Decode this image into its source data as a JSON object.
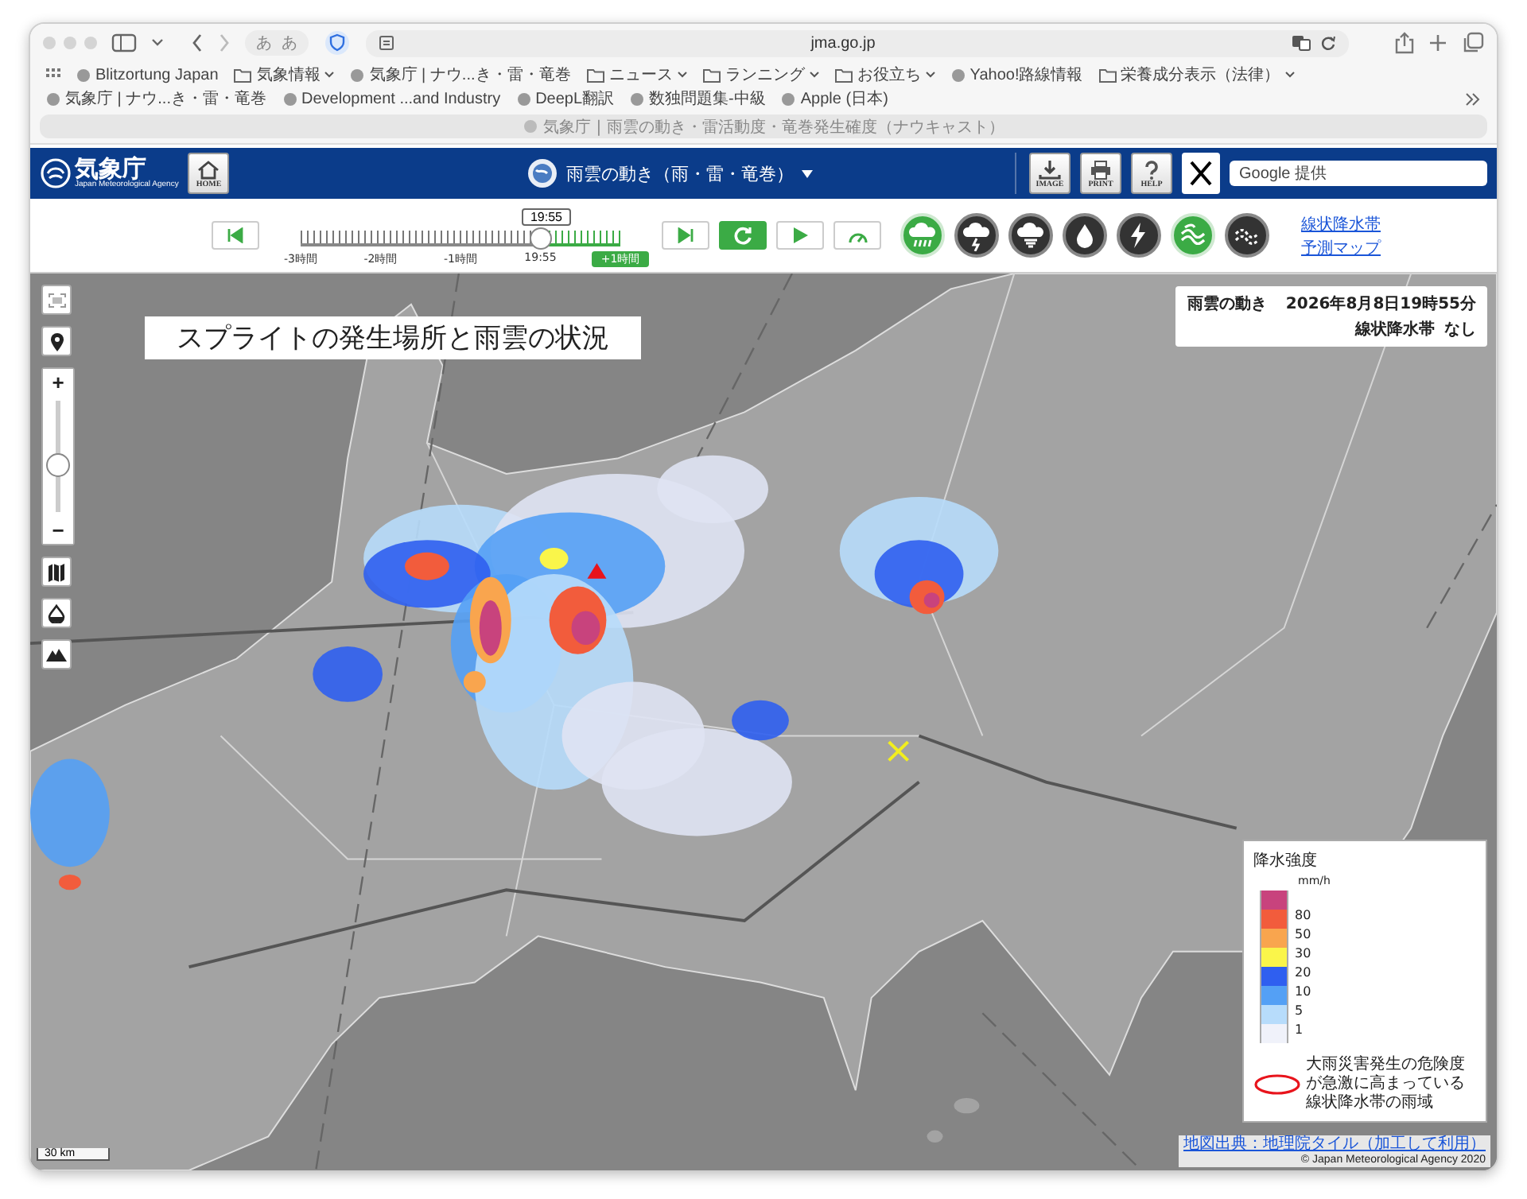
{
  "browser": {
    "address": "jma.go.jp",
    "toolbar_texts": [
      "あ",
      "あ"
    ],
    "bookmarks": [
      {
        "label": "Blitzortung Japan",
        "kind": "site"
      },
      {
        "label": "気象情報",
        "kind": "folder"
      },
      {
        "label": "気象庁 | ナウ...き・雷・竜巻",
        "kind": "site"
      },
      {
        "label": "ニュース",
        "kind": "folder"
      },
      {
        "label": "ランニング",
        "kind": "folder"
      },
      {
        "label": "お役立ち",
        "kind": "folder"
      },
      {
        "label": "Yahoo!路線情報",
        "kind": "site"
      },
      {
        "label": "栄養成分表示（法律）",
        "kind": "folder"
      },
      {
        "label": "気象庁 | ナウ...き・雷・竜巻",
        "kind": "site"
      },
      {
        "label": "Development ...and Industry",
        "kind": "site"
      },
      {
        "label": "DeepL翻訳",
        "kind": "site"
      },
      {
        "label": "数独問題集-中級",
        "kind": "site"
      },
      {
        "label": "Apple (日本)",
        "kind": "site"
      }
    ],
    "tab_title": "気象庁 | 雨雲の動き・雷活動度・竜巻発生確度（ナウキャスト）"
  },
  "header": {
    "logo_text": "気象庁",
    "logo_subtext": "Japan Meteorological Agency",
    "home_button": "HOME",
    "page_title": "雨雲の動き（雨・雷・竜巻）",
    "tools": [
      {
        "label": "IMAGE",
        "kind": "download"
      },
      {
        "label": "PRINT",
        "kind": "print"
      },
      {
        "label": "HELP",
        "kind": "help"
      }
    ],
    "search": {
      "placeholder": "Google 提供"
    }
  },
  "timeline": {
    "time_label": "19:55",
    "level": 0.75,
    "ticks": [
      "-3時間",
      "-2時間",
      "-1時間",
      "19:55",
      "+1時間"
    ],
    "buttons": [
      {
        "kind": "first",
        "selected": false
      },
      {
        "kind": "last",
        "selected": false
      },
      {
        "kind": "refresh",
        "selected": true
      },
      {
        "kind": "play",
        "selected": false
      },
      {
        "kind": "speed",
        "selected": false
      }
    ],
    "layers": [
      {
        "kind": "rain",
        "selected": true
      },
      {
        "kind": "thunder",
        "selected": false
      },
      {
        "kind": "tornado",
        "selected": false
      },
      {
        "kind": "drop",
        "selected": false
      },
      {
        "kind": "lightning",
        "selected": false
      },
      {
        "kind": "band",
        "selected": true
      },
      {
        "kind": "band-forecast",
        "selected": false
      }
    ],
    "links": [
      "線状降水帯",
      "予測マップ"
    ]
  },
  "map": {
    "zoom": {
      "in": "+",
      "out": "−",
      "level": 0.4
    },
    "overlay_title": "スプライトの発生場所と雨雲の状況",
    "info": {
      "title": "雨雲の動き",
      "datetime": "2026年8月8日19時55分",
      "band_label": "線状降水帯",
      "band_status": "なし"
    },
    "legend": {
      "title": "降水強度",
      "unit": "mm/h",
      "swatches": [
        {
          "color": "#c8437d"
        },
        {
          "color": "#f25c3c",
          "label": "80"
        },
        {
          "color": "#f9a54e",
          "label": "50"
        },
        {
          "color": "#faf54a",
          "label": "30"
        },
        {
          "color": "#2f5ff0",
          "label": "20"
        },
        {
          "color": "#54a0f5",
          "label": "10"
        },
        {
          "color": "#b7dcfb",
          "label": "5"
        },
        {
          "color": "#f0f2fa",
          "label": "1"
        }
      ],
      "note": "大雨災害発生の危険度が急激に高まっている線状降水帯の雨域"
    },
    "attribution": "地図出典：地理院タイル（加工して利用）",
    "copyright": "© Japan Meteorological Agency 2020",
    "scale": "30 km"
  }
}
